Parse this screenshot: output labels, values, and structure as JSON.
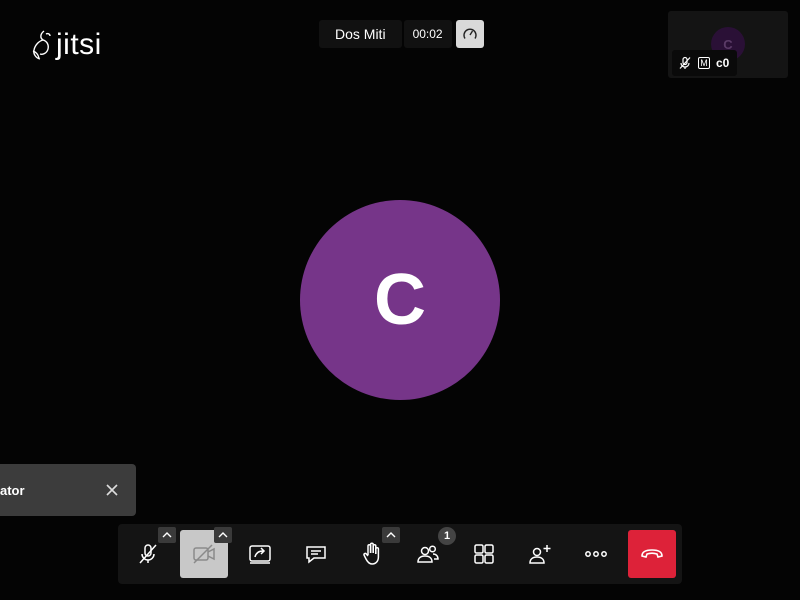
{
  "logo": {
    "text": "jitsi"
  },
  "header": {
    "meeting_name": "Dos Miti",
    "timer": "00:02"
  },
  "thumbnail": {
    "avatar_initial": "C",
    "moderator_badge": "M",
    "name": "c0"
  },
  "main": {
    "avatar_initial": "C",
    "avatar_color": "#763589"
  },
  "notification": {
    "text": "ator"
  },
  "toolbar": {
    "participants_count": "1",
    "hangup_color": "#dd2239"
  }
}
